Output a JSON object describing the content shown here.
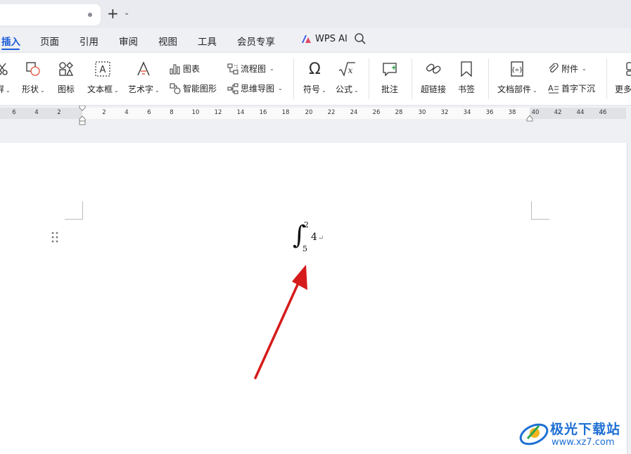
{
  "menu": {
    "tabs": [
      "插入",
      "页面",
      "引用",
      "审阅",
      "视图",
      "工具",
      "会员专享"
    ],
    "wps_ai": "WPS AI"
  },
  "ribbon": {
    "screenshot": "屏",
    "shape": "形状",
    "icons": "图标",
    "textbox": "文本框",
    "wordart": "艺术字",
    "chart": "图表",
    "smartart": "智能图形",
    "flowchart": "流程图",
    "mindmap": "思维导图",
    "symbol": "符号",
    "formula": "公式",
    "comment": "批注",
    "hyperlink": "超链接",
    "bookmark": "书签",
    "doc_parts": "文档部件",
    "attachment": "附件",
    "dropcap": "首字下沉",
    "more": "更多"
  },
  "ruler": {
    "labels": [
      "6",
      "4",
      "2",
      "2",
      "4",
      "6",
      "8",
      "10",
      "12",
      "14",
      "16",
      "18",
      "20",
      "22",
      "24",
      "26",
      "28",
      "30",
      "32",
      "34",
      "36",
      "38",
      "40",
      "42",
      "44",
      "46"
    ]
  },
  "document": {
    "integral_symbol": "∫",
    "upper_limit": "2",
    "lower_limit": "5",
    "integrand": "4",
    "paragraph_mark": "↵"
  },
  "watermark": {
    "title": "极光下载站",
    "url": "www.xz7.com"
  },
  "colors": {
    "accent": "#1b5bd6",
    "arrow": "#d61b1b"
  }
}
